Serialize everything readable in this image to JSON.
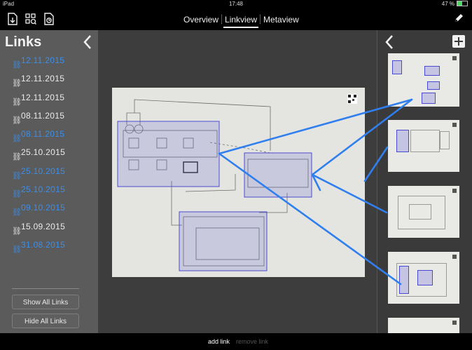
{
  "status_bar": {
    "device": "iPad",
    "time": "17:48",
    "battery": "47 %"
  },
  "tabs": [
    {
      "label": "Overview"
    },
    {
      "label": "Linkview"
    },
    {
      "label": "Metaview"
    }
  ],
  "sidebar": {
    "title": "Links",
    "links": [
      {
        "label": "12.11.2015",
        "color": "#3b8eea"
      },
      {
        "label": "12.11.2015",
        "color": "#eaeaea"
      },
      {
        "label": "12.11.2015",
        "color": "#eaeaea"
      },
      {
        "label": "08.11.2015",
        "color": "#eaeaea"
      },
      {
        "label": "08.11.2015",
        "color": "#3b8eea"
      },
      {
        "label": "25.10.2015",
        "color": "#eaeaea"
      },
      {
        "label": "25.10.2015",
        "color": "#3b8eea"
      },
      {
        "label": "25.10.2015",
        "color": "#3b8eea"
      },
      {
        "label": "09.10.2015",
        "color": "#3b8eea"
      },
      {
        "label": "15.09.2015",
        "color": "#eaeaea"
      },
      {
        "label": "31.08.2015",
        "color": "#3b8eea"
      }
    ],
    "show_all": "Show All Links",
    "hide_all": "Hide All Links"
  },
  "bottom": {
    "add_link": "add link",
    "remove_link": "remove link"
  },
  "colors": {
    "link_blue": "#3b8eea",
    "region": "#4a4ad0"
  },
  "icons": {
    "import": "import-photo-icon",
    "qr": "qr-scan-icon",
    "export": "export-document-icon",
    "edit": "pencil-icon"
  }
}
